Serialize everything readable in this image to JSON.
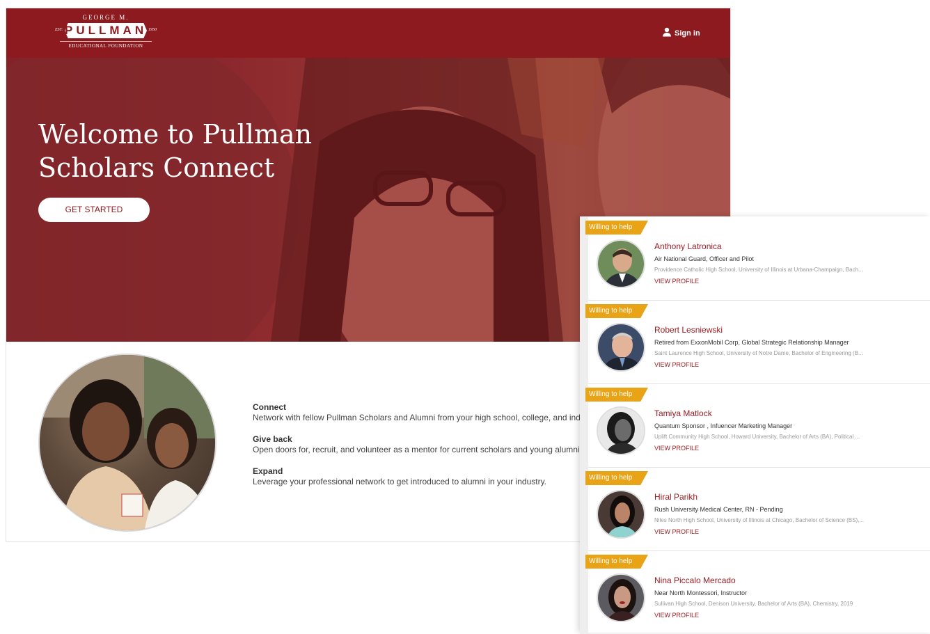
{
  "logo": {
    "top": "GEORGE M.",
    "name": "PULLMAN",
    "est": "EST.",
    "year": "1950",
    "subtitle": "EDUCATIONAL FOUNDATION"
  },
  "header": {
    "signin_label": "Sign in"
  },
  "hero": {
    "title": "Welcome to Pullman Scholars Connect",
    "cta_label": "GET STARTED"
  },
  "features": [
    {
      "title": "Connect",
      "desc": "Network with fellow Pullman Scholars and Alumni from your high school, college, and ind"
    },
    {
      "title": "Give back",
      "desc": "Open doors for, recruit, and volunteer as a mentor for current scholars and young alumni p"
    },
    {
      "title": "Expand",
      "desc": "Leverage your professional network to get introduced to alumni in your industry."
    }
  ],
  "helpers": [
    {
      "badge": "Willing to help",
      "name": "Anthony Latronica",
      "job": "Air National Guard, Officer and Pilot",
      "edu": "Providence Catholic High School, University of Illinois at Urbana-Champaign, Bach...",
      "view": "VIEW PROFILE"
    },
    {
      "badge": "Willing to help",
      "name": "Robert Lesniewski",
      "job": "Retired from ExxonMobil Corp, Global Strategic Relationship Manager",
      "edu": "Saint Laurence High School, University of Notre Dame, Bachelor of Engineering (B...",
      "view": "VIEW PROFILE"
    },
    {
      "badge": "Willing to help",
      "name": "Tamiya Matlock",
      "job": "Quantum Sponsor , Infuencer Marketing Manager",
      "edu": "Uplift Community High School, Howard University, Bachelor of Arts (BA), Political ...",
      "view": "VIEW PROFILE"
    },
    {
      "badge": "Willing to help",
      "name": "Hiral Parikh",
      "job": "Rush University Medical Center, RN - Pending",
      "edu": "Niles North High School, University of Illinois at Chicago, Bachelor of Science (BS),...",
      "view": "VIEW PROFILE"
    },
    {
      "badge": "Willing to help",
      "name": "Nina Piccalo Mercado",
      "job": "Near North Montessori, Instructor",
      "edu": "Sullivan High School, Denison University, Bachelor of Arts (BA), Chemistry, 2019",
      "view": "VIEW PROFILE"
    }
  ],
  "colors": {
    "brand": "#8c1a1f",
    "badge": "#e8a317",
    "link": "#9b1c22"
  }
}
